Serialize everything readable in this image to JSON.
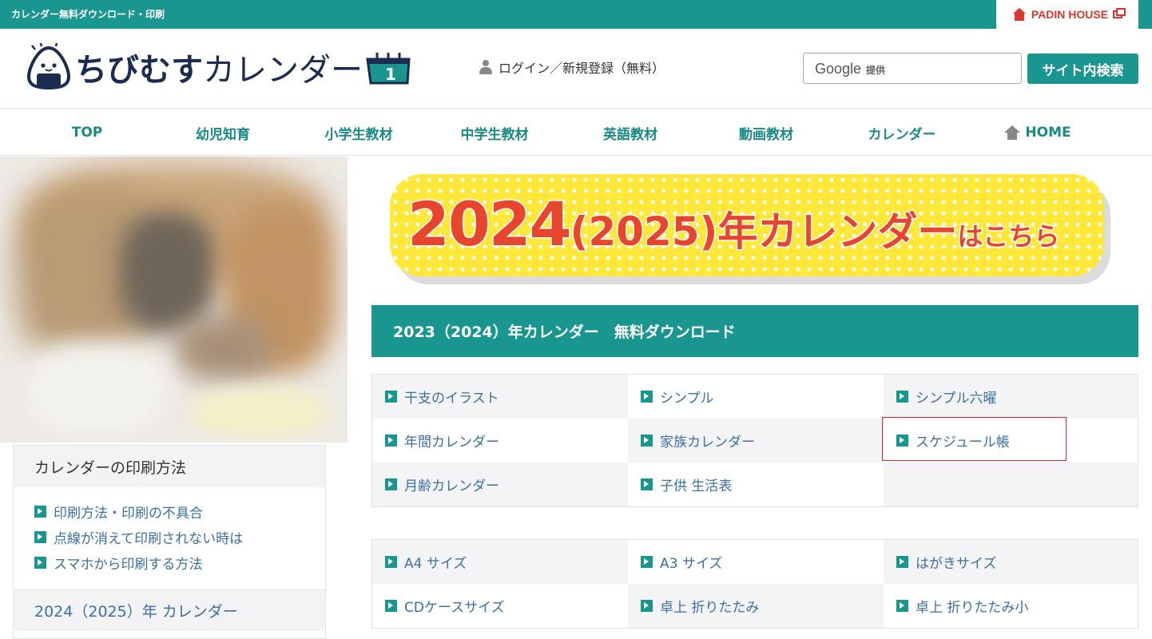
{
  "topbar": {
    "title": "カレンダー無料ダウンロード・印刷",
    "partner": "PADIN HOUSE"
  },
  "header": {
    "logo_bold": "ちびむす",
    "logo_light": "カレンダー",
    "logo_calendar_day": "1",
    "login_label": "ログイン／新規登録（無料）",
    "search_provider": "Google",
    "search_provider_suffix": "提供",
    "search_button": "サイト内検索"
  },
  "nav": {
    "items": [
      "TOP",
      "幼児知育",
      "小学生教材",
      "中学生教材",
      "英語教材",
      "動画教材",
      "カレンダー",
      "HOME"
    ]
  },
  "sidebar": {
    "print_heading": "カレンダーの印刷方法",
    "print_links": [
      "印刷方法・印刷の不具合",
      "点線が消えて印刷されない時は",
      "スマホから印刷する方法"
    ],
    "next_heading": "2024（2025）年 カレンダー"
  },
  "banner": {
    "year": "2024",
    "paren_year": "(2025)",
    "suffix": "年カレンダー",
    "tail": "はこちら"
  },
  "main": {
    "section_title": "2023（2024）年カレンダー　無料ダウンロード",
    "categories": [
      [
        "干支のイラスト",
        "シンプル",
        "シンプル六曜"
      ],
      [
        "年間カレンダー",
        "家族カレンダー",
        "スケジュール帳"
      ],
      [
        "月齢カレンダー",
        "子供 生活表",
        ""
      ]
    ],
    "sizes": [
      [
        "A4 サイズ",
        "A3 サイズ",
        "はがきサイズ"
      ],
      [
        "CDケースサイズ",
        "卓上 折りたたみ",
        "卓上 折りたたみ小"
      ]
    ]
  },
  "colors": {
    "teal": "#1a9690",
    "link": "#3a6fa8",
    "banner_red": "#e8452f",
    "banner_yellow": "#ffe83a",
    "highlight": "#e0262c"
  }
}
